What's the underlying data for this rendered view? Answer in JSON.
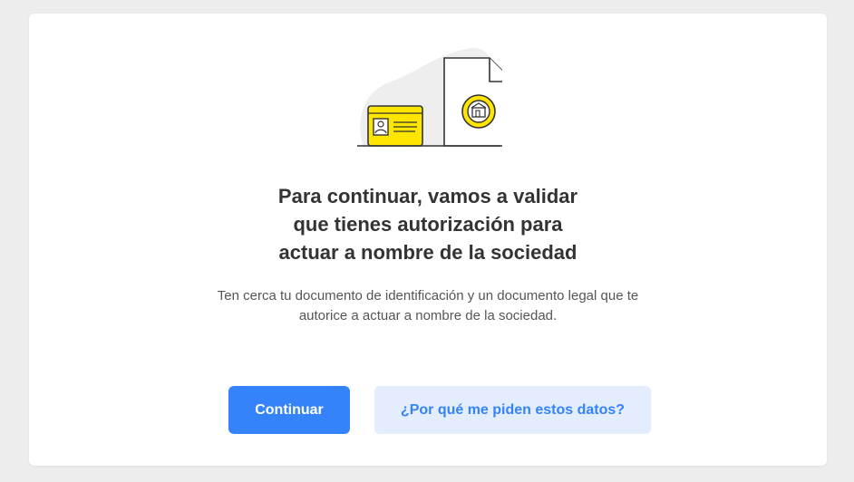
{
  "content": {
    "title_lines": [
      "Para continuar, vamos a validar",
      "que tienes autorización para",
      "actuar a nombre de la sociedad"
    ],
    "subtitle_lines": [
      "Ten cerca tu documento de identificación y un documento legal que te",
      "autorice a actuar a nombre de la sociedad."
    ]
  },
  "actions": {
    "continue_label": "Continuar",
    "why_label": "¿Por qué me piden estos datos?"
  },
  "colors": {
    "primary": "#3483fa",
    "secondary_bg": "#e3edfb",
    "accent_yellow": "#ffe600"
  },
  "icons": {
    "illustration": "id-card-and-document-illustration"
  }
}
